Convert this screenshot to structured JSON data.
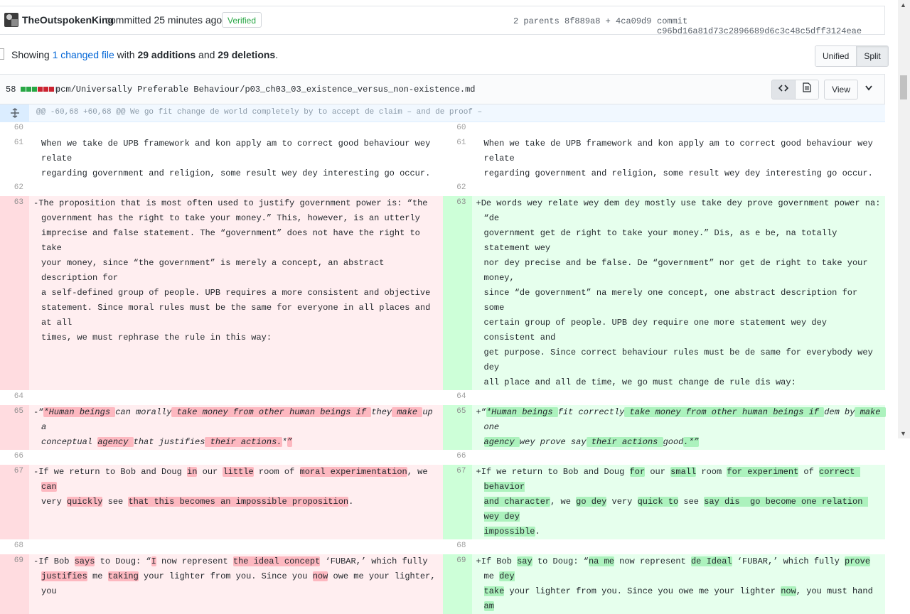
{
  "commit": {
    "author": "TheOutspokenKing",
    "committed_text": "committed 25 minutes ago",
    "verified_label": "Verified",
    "parents_label": "2 parents",
    "parent1": "8f889a8",
    "plus": "+",
    "parent2": "4ca09d9",
    "commit_label": "commit",
    "commit_sha": "c96bd16a81d73c2896689d6c3c48c5dff3124eae"
  },
  "summary": {
    "showing": "Showing",
    "changed_files": "1 changed file",
    "with": "with",
    "additions": "29 additions",
    "and": "and",
    "deletions": "29 deletions",
    "period": "."
  },
  "view_toggle": {
    "unified": "Unified",
    "split": "Split"
  },
  "file": {
    "change_count": "58",
    "path": "pcm/Universally Preferable Behaviour/p03_ch03_03_existence_versus_non-existence.md",
    "view_label": "View",
    "diffstat": [
      "#28a745",
      "#28a745",
      "#28a745",
      "#cb2431",
      "#cb2431",
      "#cb2431",
      "#d1d5da"
    ]
  },
  "hunk": {
    "header": "@@ -60,68 +60,68 @@ We go fit change de world completely by to accept de claim – and de proof –"
  },
  "left_nums": [
    "60",
    "61",
    "62",
    "63",
    "64",
    "65",
    "66",
    "67",
    "68",
    "69"
  ],
  "right_nums": [
    "60",
    "61",
    "62",
    "63",
    "64",
    "65",
    "66",
    "67",
    "68",
    "69"
  ],
  "line61": "When we take de UPB framework and kon apply am to correct good behaviour wey relate\nregarding government and religion, some result wey dey interesting go occur.",
  "del63": "-The proposition that is most often used to justify government power is: “the\ngovernment has the right to take your money.” This, however, is an utterly\nimprecise and false statement. The “government” does not have the right to take\nyour money, since “the government” is merely a concept, an abstract description for\na self-defined group of people. UPB requires a more consistent and objective\nstatement. Since moral rules must be the same for everyone in all places and at all\ntimes, we must rephrase the rule in this way:",
  "add63": "+De words wey relate wey dem dey mostly use take dey prove government power na: “de\ngovernment get de right to take your money.” Dis, as e be, na totally statement wey\nnor dey precise and be false. De “government” nor get de right to take your money,\nsince “de government” na merely one concept, one abstract description for some\ncertain group of people. UPB dey require one more statement wey dey consistent and\nget purpose. Since correct behaviour rules must be de same for everybody wey dey\nall place and all de time, we go must change de rule dis way:",
  "del65": {
    "s": [
      "-“",
      "*Human beings ",
      "can morally",
      " take money from other human beings if ",
      "they",
      " make ",
      "up a\nconceptual ",
      "agency ",
      "that justifies",
      " their actions.",
      "*",
      "”"
    ]
  },
  "add65": {
    "s": [
      "+“",
      "*Human beings ",
      "fit correctly",
      " take money from other human beings if ",
      "dem by",
      " make ",
      "one\n",
      "agency ",
      "wey prove say",
      " their actions ",
      "good",
      ".*”"
    ]
  },
  "del67": {
    "s": [
      "-If we return to Bob and Doug ",
      "in",
      " our ",
      "little",
      " room of ",
      "moral experimentation",
      ", we ",
      "can",
      "\nvery ",
      "quickly",
      " see ",
      "that this becomes an impossible proposition",
      "."
    ]
  },
  "add67": {
    "s": [
      "+If we return to Bob and Doug ",
      "for",
      " our ",
      "small",
      " room ",
      "for experiment",
      " of ",
      "correct behavior\nand character",
      ", we ",
      "go dey",
      " very ",
      "quick to",
      " see ",
      "say dis  go become one relation wey dey\nimpossible",
      "."
    ]
  },
  "del69": {
    "s": [
      "-If Bob ",
      "says",
      " to Doug: “",
      "I",
      " now represent ",
      "the ideal concept",
      " ‘FUBAR,’ which fully\n",
      "justifies",
      " me ",
      "taking",
      " your lighter from you. Since you ",
      "now",
      " owe me your lighter, you"
    ]
  },
  "add69": {
    "s": [
      "+If Bob ",
      "say",
      " to Doug: “",
      "na me",
      " now represent ",
      "de Ideal",
      " ‘FUBAR,’ which fully ",
      "prove",
      " me ",
      "dey\ntake",
      " your lighter from you. Since you owe me your lighter ",
      "now",
      ", you must hand ",
      "am"
    ]
  }
}
